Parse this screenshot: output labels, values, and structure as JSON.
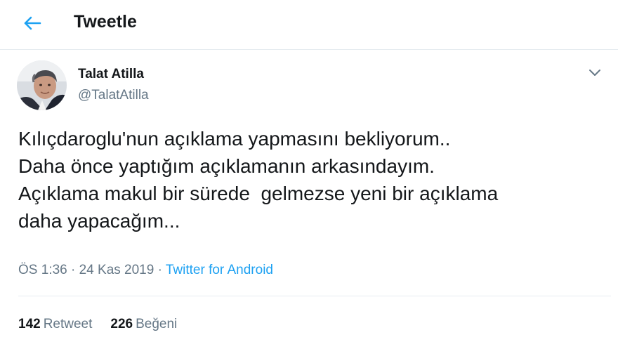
{
  "header": {
    "back_icon": "arrow-left-icon",
    "title": "Tweetle"
  },
  "tweet": {
    "author": {
      "display_name": "Talat Atilla",
      "handle": "@TalatAtilla",
      "avatar_icon": "profile-photo"
    },
    "caret_icon": "chevron-down-icon",
    "text_lines": [
      "Kılıçdaroglu'nun açıklama yapmasını bekliyorum..",
      "Daha önce yaptığım açıklamanın arkasındayım.",
      "Açıklama makul bir sürede  gelmezse yeni bir açıklama",
      "daha yapacağım..."
    ],
    "time": "ÖS 1:36",
    "separator": " · ",
    "date": "24 Kas 2019",
    "source": "Twitter for Android"
  },
  "stats": {
    "retweet_count": "142",
    "retweet_label": "Retweet",
    "like_count": "226",
    "like_label": "Beğeni"
  },
  "colors": {
    "accent": "#1da1f2",
    "text": "#14171a",
    "muted": "#657786",
    "border": "#e6ecf0"
  }
}
